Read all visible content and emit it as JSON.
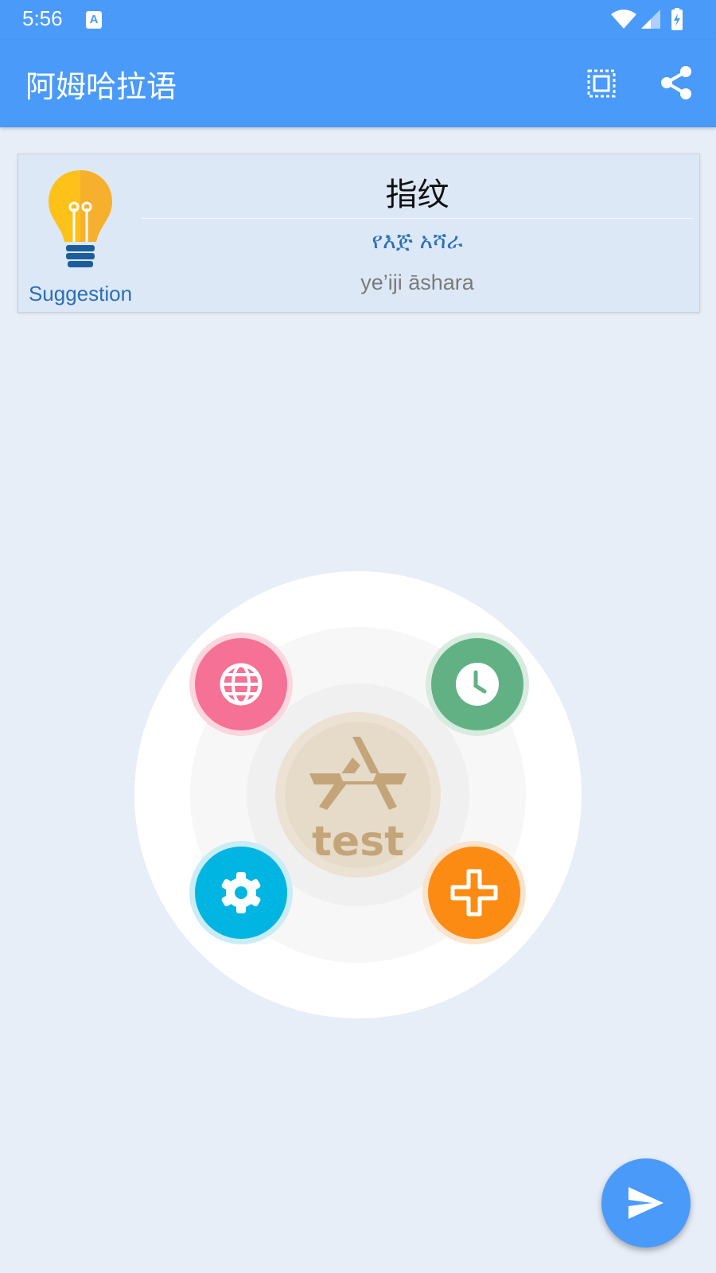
{
  "status_bar": {
    "time": "5:56",
    "notification_icon": "text-a-icon",
    "notification_glyph": "A",
    "right_icons": [
      "wifi-icon",
      "signal-icon",
      "battery-icon"
    ]
  },
  "app_bar": {
    "title": "阿姆哈拉语",
    "actions": [
      "fullscreen-icon",
      "share-icon"
    ]
  },
  "suggestion_card": {
    "label": "Suggestion",
    "icon": "lightbulb-icon",
    "word": "指纹",
    "native": "የእጅ አሻራ",
    "romanized": "ye’iji āshara"
  },
  "radial_menu": {
    "center_text": "test",
    "center_icon": "app-store-icon",
    "buttons": [
      {
        "icon": "globe-icon",
        "color": "#f67196"
      },
      {
        "icon": "clock-icon",
        "color": "#62b184"
      },
      {
        "icon": "gear-icon",
        "color": "#00b5e2"
      },
      {
        "icon": "plus-icon",
        "color": "#fc8b14"
      }
    ]
  },
  "fab": {
    "icon": "send-icon",
    "color": "#4a9af9"
  },
  "colors": {
    "primary": "#4a9af9",
    "background": "#e8eef8",
    "card": "#dde8f7",
    "accent_text": "#2a6fb5"
  }
}
